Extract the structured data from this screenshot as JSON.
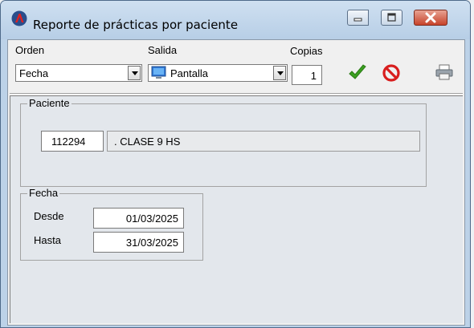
{
  "window": {
    "title": "Reporte de prácticas por paciente"
  },
  "toolbar": {
    "orden_label": "Orden",
    "orden_value": "Fecha",
    "salida_label": "Salida",
    "salida_value": "Pantalla",
    "copias_label": "Copias",
    "copias_value": "1"
  },
  "paciente": {
    "legend": "Paciente",
    "id": "112294",
    "nombre": ". CLASE  9 HS"
  },
  "fecha": {
    "legend": "Fecha",
    "desde_label": "Desde",
    "desde_value": "01/03/2025",
    "hasta_label": "Hasta",
    "hasta_value": "31/03/2025"
  },
  "colors": {
    "accept": "#3aa020",
    "cancel": "#d81e1e",
    "title_bar": "#c3d8ee"
  },
  "icons": [
    "app-logo-icon",
    "minimize-icon",
    "maximize-icon",
    "close-icon",
    "monitor-icon",
    "checkmark-icon",
    "cancel-icon",
    "printer-icon"
  ]
}
